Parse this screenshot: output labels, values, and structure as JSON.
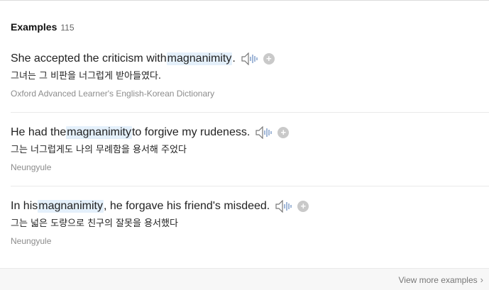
{
  "header": {
    "title": "Examples",
    "count": "115"
  },
  "examples": [
    {
      "pre": "She accepted the criticism with ",
      "highlight": "magnanimity",
      "post": ".",
      "translation": "그녀는 그 비판을 너그럽게 받아들였다.",
      "source": "Oxford Advanced Learner's English-Korean Dictionary"
    },
    {
      "pre": "He had the ",
      "highlight": "magnanimity",
      "post": " to forgive my rudeness.",
      "translation": "그는 너그럽게도 나의 무례함을 용서해 주었다",
      "source": "Neungyule"
    },
    {
      "pre": "In his ",
      "highlight": "magnanimity",
      "post": ", he forgave his friend's misdeed.",
      "translation": "그는 넓은 도량으로 친구의 잘못을 용서했다",
      "source": "Neungyule"
    }
  ],
  "footer": {
    "view_more": "View more examples"
  },
  "icons": {
    "speaker": "speaker-icon",
    "add": "plus-circle-icon",
    "chevron": "chevron-right-icon"
  },
  "colors": {
    "highlight": "#e4f0fb",
    "icon_gray": "#c9c9c9",
    "source_gray": "#8c8c8c"
  }
}
